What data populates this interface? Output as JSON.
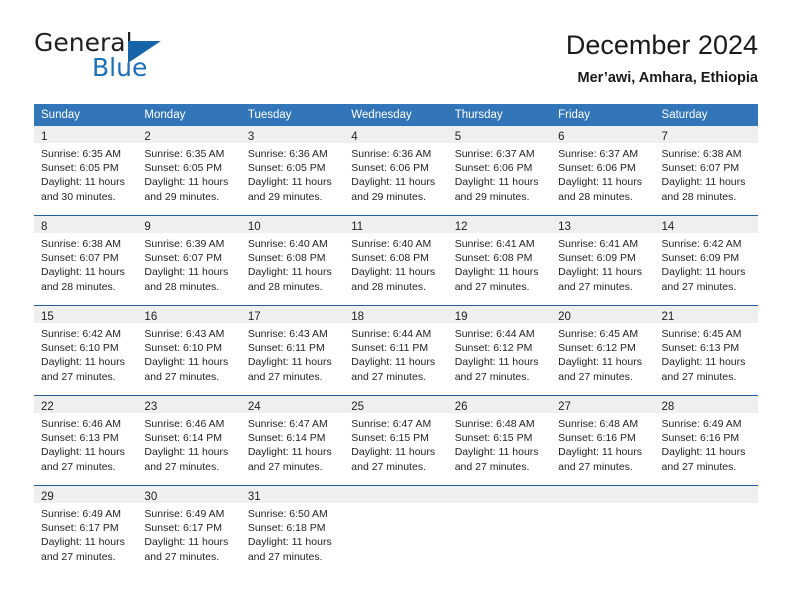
{
  "brand": {
    "name_part1": "General",
    "name_part2": "Blue",
    "logo_icon": "triangle-logo-icon"
  },
  "header": {
    "title": "December 2024",
    "location": "Mer’awi, Amhara, Ethiopia"
  },
  "weekday_headers": [
    "Sunday",
    "Monday",
    "Tuesday",
    "Wednesday",
    "Thursday",
    "Friday",
    "Saturday"
  ],
  "colors": {
    "header_blue": "#3275b8",
    "row_border_blue": "#1f5fa0",
    "daynum_band": "#efefef",
    "brand_blue": "#1c71b8",
    "text": "#231f20"
  },
  "weeks": [
    [
      {
        "day": "1",
        "sunrise": "Sunrise: 6:35 AM",
        "sunset": "Sunset: 6:05 PM",
        "daylight_line1": "Daylight: 11 hours",
        "daylight_line2": "and 30 minutes."
      },
      {
        "day": "2",
        "sunrise": "Sunrise: 6:35 AM",
        "sunset": "Sunset: 6:05 PM",
        "daylight_line1": "Daylight: 11 hours",
        "daylight_line2": "and 29 minutes."
      },
      {
        "day": "3",
        "sunrise": "Sunrise: 6:36 AM",
        "sunset": "Sunset: 6:05 PM",
        "daylight_line1": "Daylight: 11 hours",
        "daylight_line2": "and 29 minutes."
      },
      {
        "day": "4",
        "sunrise": "Sunrise: 6:36 AM",
        "sunset": "Sunset: 6:06 PM",
        "daylight_line1": "Daylight: 11 hours",
        "daylight_line2": "and 29 minutes."
      },
      {
        "day": "5",
        "sunrise": "Sunrise: 6:37 AM",
        "sunset": "Sunset: 6:06 PM",
        "daylight_line1": "Daylight: 11 hours",
        "daylight_line2": "and 29 minutes."
      },
      {
        "day": "6",
        "sunrise": "Sunrise: 6:37 AM",
        "sunset": "Sunset: 6:06 PM",
        "daylight_line1": "Daylight: 11 hours",
        "daylight_line2": "and 28 minutes."
      },
      {
        "day": "7",
        "sunrise": "Sunrise: 6:38 AM",
        "sunset": "Sunset: 6:07 PM",
        "daylight_line1": "Daylight: 11 hours",
        "daylight_line2": "and 28 minutes."
      }
    ],
    [
      {
        "day": "8",
        "sunrise": "Sunrise: 6:38 AM",
        "sunset": "Sunset: 6:07 PM",
        "daylight_line1": "Daylight: 11 hours",
        "daylight_line2": "and 28 minutes."
      },
      {
        "day": "9",
        "sunrise": "Sunrise: 6:39 AM",
        "sunset": "Sunset: 6:07 PM",
        "daylight_line1": "Daylight: 11 hours",
        "daylight_line2": "and 28 minutes."
      },
      {
        "day": "10",
        "sunrise": "Sunrise: 6:40 AM",
        "sunset": "Sunset: 6:08 PM",
        "daylight_line1": "Daylight: 11 hours",
        "daylight_line2": "and 28 minutes."
      },
      {
        "day": "11",
        "sunrise": "Sunrise: 6:40 AM",
        "sunset": "Sunset: 6:08 PM",
        "daylight_line1": "Daylight: 11 hours",
        "daylight_line2": "and 28 minutes."
      },
      {
        "day": "12",
        "sunrise": "Sunrise: 6:41 AM",
        "sunset": "Sunset: 6:08 PM",
        "daylight_line1": "Daylight: 11 hours",
        "daylight_line2": "and 27 minutes."
      },
      {
        "day": "13",
        "sunrise": "Sunrise: 6:41 AM",
        "sunset": "Sunset: 6:09 PM",
        "daylight_line1": "Daylight: 11 hours",
        "daylight_line2": "and 27 minutes."
      },
      {
        "day": "14",
        "sunrise": "Sunrise: 6:42 AM",
        "sunset": "Sunset: 6:09 PM",
        "daylight_line1": "Daylight: 11 hours",
        "daylight_line2": "and 27 minutes."
      }
    ],
    [
      {
        "day": "15",
        "sunrise": "Sunrise: 6:42 AM",
        "sunset": "Sunset: 6:10 PM",
        "daylight_line1": "Daylight: 11 hours",
        "daylight_line2": "and 27 minutes."
      },
      {
        "day": "16",
        "sunrise": "Sunrise: 6:43 AM",
        "sunset": "Sunset: 6:10 PM",
        "daylight_line1": "Daylight: 11 hours",
        "daylight_line2": "and 27 minutes."
      },
      {
        "day": "17",
        "sunrise": "Sunrise: 6:43 AM",
        "sunset": "Sunset: 6:11 PM",
        "daylight_line1": "Daylight: 11 hours",
        "daylight_line2": "and 27 minutes."
      },
      {
        "day": "18",
        "sunrise": "Sunrise: 6:44 AM",
        "sunset": "Sunset: 6:11 PM",
        "daylight_line1": "Daylight: 11 hours",
        "daylight_line2": "and 27 minutes."
      },
      {
        "day": "19",
        "sunrise": "Sunrise: 6:44 AM",
        "sunset": "Sunset: 6:12 PM",
        "daylight_line1": "Daylight: 11 hours",
        "daylight_line2": "and 27 minutes."
      },
      {
        "day": "20",
        "sunrise": "Sunrise: 6:45 AM",
        "sunset": "Sunset: 6:12 PM",
        "daylight_line1": "Daylight: 11 hours",
        "daylight_line2": "and 27 minutes."
      },
      {
        "day": "21",
        "sunrise": "Sunrise: 6:45 AM",
        "sunset": "Sunset: 6:13 PM",
        "daylight_line1": "Daylight: 11 hours",
        "daylight_line2": "and 27 minutes."
      }
    ],
    [
      {
        "day": "22",
        "sunrise": "Sunrise: 6:46 AM",
        "sunset": "Sunset: 6:13 PM",
        "daylight_line1": "Daylight: 11 hours",
        "daylight_line2": "and 27 minutes."
      },
      {
        "day": "23",
        "sunrise": "Sunrise: 6:46 AM",
        "sunset": "Sunset: 6:14 PM",
        "daylight_line1": "Daylight: 11 hours",
        "daylight_line2": "and 27 minutes."
      },
      {
        "day": "24",
        "sunrise": "Sunrise: 6:47 AM",
        "sunset": "Sunset: 6:14 PM",
        "daylight_line1": "Daylight: 11 hours",
        "daylight_line2": "and 27 minutes."
      },
      {
        "day": "25",
        "sunrise": "Sunrise: 6:47 AM",
        "sunset": "Sunset: 6:15 PM",
        "daylight_line1": "Daylight: 11 hours",
        "daylight_line2": "and 27 minutes."
      },
      {
        "day": "26",
        "sunrise": "Sunrise: 6:48 AM",
        "sunset": "Sunset: 6:15 PM",
        "daylight_line1": "Daylight: 11 hours",
        "daylight_line2": "and 27 minutes."
      },
      {
        "day": "27",
        "sunrise": "Sunrise: 6:48 AM",
        "sunset": "Sunset: 6:16 PM",
        "daylight_line1": "Daylight: 11 hours",
        "daylight_line2": "and 27 minutes."
      },
      {
        "day": "28",
        "sunrise": "Sunrise: 6:49 AM",
        "sunset": "Sunset: 6:16 PM",
        "daylight_line1": "Daylight: 11 hours",
        "daylight_line2": "and 27 minutes."
      }
    ],
    [
      {
        "day": "29",
        "sunrise": "Sunrise: 6:49 AM",
        "sunset": "Sunset: 6:17 PM",
        "daylight_line1": "Daylight: 11 hours",
        "daylight_line2": "and 27 minutes."
      },
      {
        "day": "30",
        "sunrise": "Sunrise: 6:49 AM",
        "sunset": "Sunset: 6:17 PM",
        "daylight_line1": "Daylight: 11 hours",
        "daylight_line2": "and 27 minutes."
      },
      {
        "day": "31",
        "sunrise": "Sunrise: 6:50 AM",
        "sunset": "Sunset: 6:18 PM",
        "daylight_line1": "Daylight: 11 hours",
        "daylight_line2": "and 27 minutes."
      },
      {
        "day": "",
        "sunrise": "",
        "sunset": "",
        "daylight_line1": "",
        "daylight_line2": ""
      },
      {
        "day": "",
        "sunrise": "",
        "sunset": "",
        "daylight_line1": "",
        "daylight_line2": ""
      },
      {
        "day": "",
        "sunrise": "",
        "sunset": "",
        "daylight_line1": "",
        "daylight_line2": ""
      },
      {
        "day": "",
        "sunrise": "",
        "sunset": "",
        "daylight_line1": "",
        "daylight_line2": ""
      }
    ]
  ]
}
